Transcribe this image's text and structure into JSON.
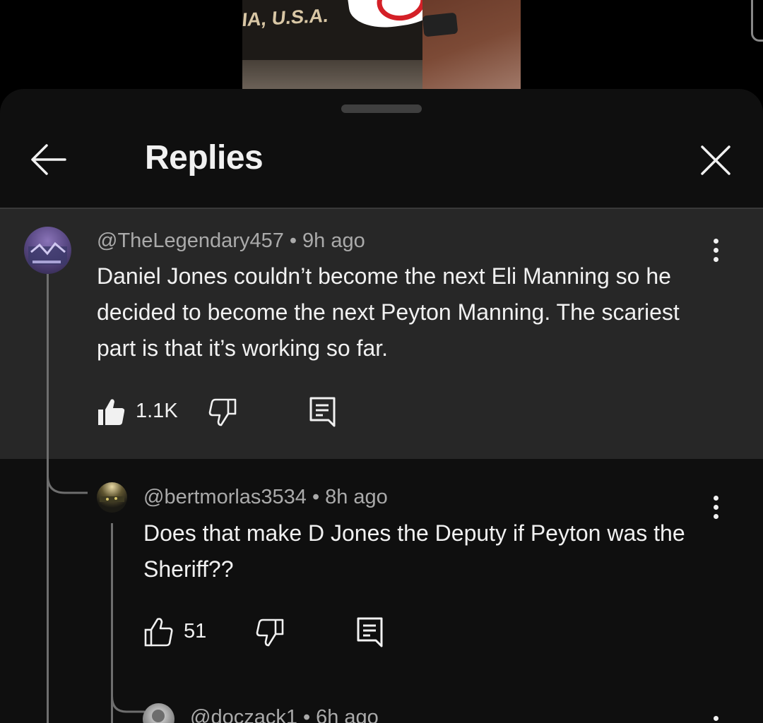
{
  "video": {
    "overlay_text": "IA, U.S.A."
  },
  "header": {
    "title": "Replies",
    "back_icon": "arrow-left-icon",
    "close_icon": "close-icon"
  },
  "comments": [
    {
      "author": "@TheLegendary457",
      "separator": "•",
      "time": "9h ago",
      "text": "Daniel Jones couldn’t become the next Eli Manning so he decided to become the next Peyton Manning. The scariest part is that it’s working so far.",
      "likes": "1.1K",
      "liked": true
    },
    {
      "author": "@bertmorlas3534",
      "separator": "•",
      "time": "8h ago",
      "text": "Does that make D Jones the Deputy if Peyton was the Sheriff??",
      "likes": "51",
      "liked": false
    },
    {
      "author": "@doczack1",
      "separator": "•",
      "time": "6h ago"
    }
  ],
  "colors": {
    "sheet": "#0f0f0f",
    "highlight": "#272727",
    "text": "#f1f1f1",
    "meta": "#aaaaaa"
  }
}
